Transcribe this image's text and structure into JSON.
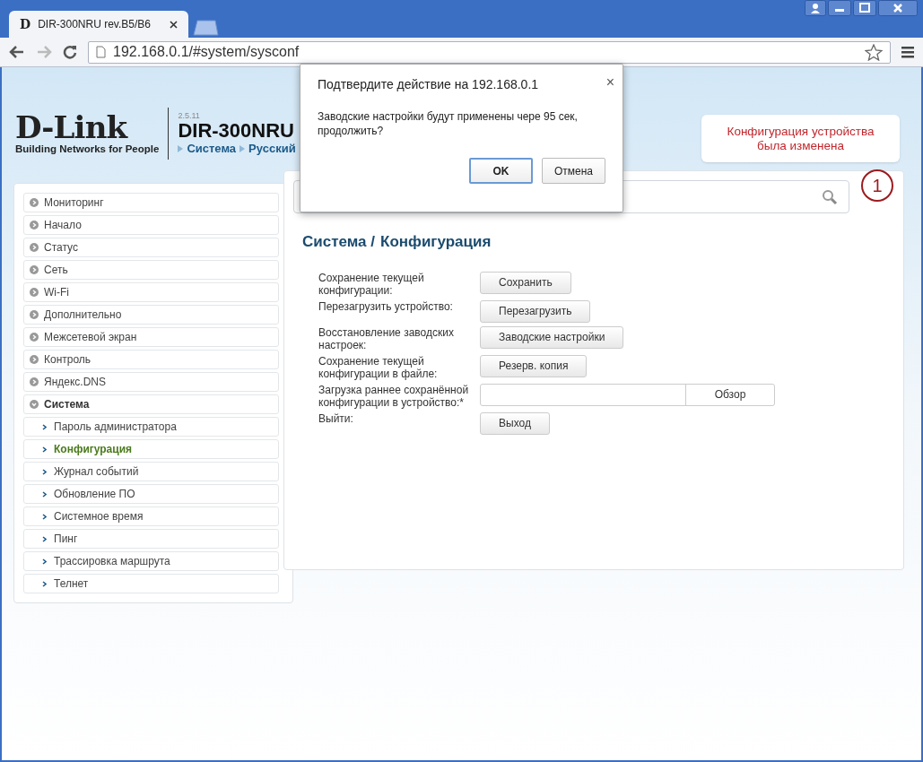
{
  "browser": {
    "tab": {
      "favicon": "D",
      "title": "DIR-300NRU rev.B5/B6"
    },
    "url": "192.168.0.1/#system/sysconf"
  },
  "header": {
    "logo": "D-Link",
    "tagline": "Building Networks for People",
    "version": "2.5.11",
    "model": "DIR-300NRU",
    "breadcrumb": [
      "Система",
      "Русский"
    ]
  },
  "notification": {
    "text": "Конфигурация устройства была изменена",
    "count": "1"
  },
  "menu": [
    {
      "label": "Мониторинг",
      "expanded": false
    },
    {
      "label": "Начало",
      "expanded": false
    },
    {
      "label": "Статус",
      "expanded": false
    },
    {
      "label": "Сеть",
      "expanded": false
    },
    {
      "label": "Wi-Fi",
      "expanded": false
    },
    {
      "label": "Дополнительно",
      "expanded": false
    },
    {
      "label": "Межсетевой экран",
      "expanded": false
    },
    {
      "label": "Контроль",
      "expanded": false
    },
    {
      "label": "Яндекс.DNS",
      "expanded": false
    },
    {
      "label": "Система",
      "expanded": true,
      "children": [
        {
          "label": "Пароль администратора",
          "selected": false
        },
        {
          "label": "Конфигурация",
          "selected": true
        },
        {
          "label": "Журнал событий",
          "selected": false
        },
        {
          "label": "Обновление ПО",
          "selected": false
        },
        {
          "label": "Системное время",
          "selected": false
        },
        {
          "label": "Пинг",
          "selected": false
        },
        {
          "label": "Трассировка маршрута",
          "selected": false
        },
        {
          "label": "Телнет",
          "selected": false
        }
      ]
    }
  ],
  "page": {
    "section": "Система /",
    "title": "Конфигурация"
  },
  "rows": [
    {
      "label": "Сохранение текущей конфигурации:",
      "kind": "button",
      "button": "Сохранить"
    },
    {
      "label": "Перезагрузить устройство:",
      "kind": "button",
      "button": "Перезагрузить"
    },
    {
      "label": "Восстановление заводских настроек:",
      "kind": "button",
      "button": "Заводские настройки"
    },
    {
      "label": "Сохранение текущей конфигурации в файле:",
      "kind": "button",
      "button": "Резерв. копия"
    },
    {
      "label": "Загрузка раннее сохранённой конфигурации в устройство:*",
      "kind": "file",
      "button": "Обзор"
    },
    {
      "label": "Выйти:",
      "kind": "button",
      "button": "Выход"
    }
  ],
  "dialog": {
    "title": "Подтвердите действие на 192.168.0.1",
    "close": "×",
    "message": "Заводские настройки будут применены чере 95 сек, продолжить?",
    "buttons": [
      {
        "label": "OK",
        "kind": "primary"
      },
      {
        "label": "Отмена",
        "kind": "secondary"
      }
    ]
  }
}
